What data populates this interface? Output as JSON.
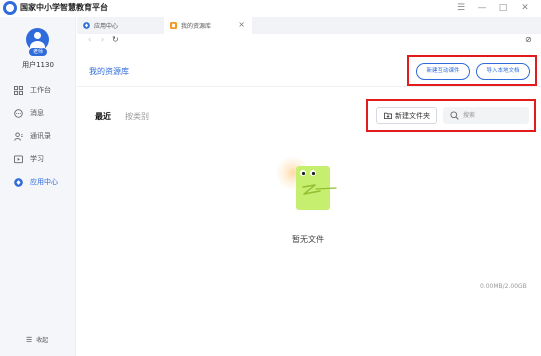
{
  "app": {
    "title": "国家中小学智慧教育平台"
  },
  "window_controls": {
    "menu": "☰",
    "minimize": "—",
    "maximize": "□",
    "close": "✕"
  },
  "sidebar": {
    "user": {
      "role_badge": "老师",
      "name": "用户1130"
    },
    "items": [
      {
        "label": "工作台",
        "icon": "workbench-icon",
        "active": false
      },
      {
        "label": "消息",
        "icon": "message-icon",
        "active": false
      },
      {
        "label": "通讯录",
        "icon": "contacts-icon",
        "active": false
      },
      {
        "label": "学习",
        "icon": "study-icon",
        "active": false
      },
      {
        "label": "应用中心",
        "icon": "app-center-icon",
        "active": true
      }
    ],
    "collapse": {
      "glyph": "☰",
      "label": "收起"
    }
  },
  "tabs": [
    {
      "label": "应用中心",
      "icon": "app-center-icon",
      "active": false
    },
    {
      "label": "我的资源库",
      "icon": "resource-library-icon",
      "active": true,
      "close": "×"
    }
  ],
  "nav": {
    "back": "‹",
    "forward": "›",
    "refresh": "↻",
    "settings": "⊘"
  },
  "page": {
    "title": "我的资源库",
    "actions": {
      "new_interactive": "新建互动课件",
      "import_local": "导入本地文档"
    },
    "filters": [
      {
        "label": "最近",
        "active": true
      },
      {
        "label": "按类别",
        "active": false
      }
    ],
    "new_folder": "新建文件夹",
    "search": {
      "placeholder": "搜索",
      "value": ""
    },
    "empty_text": "暂无文件",
    "storage": "0.00MB/2.00GB"
  },
  "colors": {
    "accent": "#2f6bdb",
    "highlight": "#e31b1b",
    "sidebar_bg": "#f4f6fa"
  }
}
